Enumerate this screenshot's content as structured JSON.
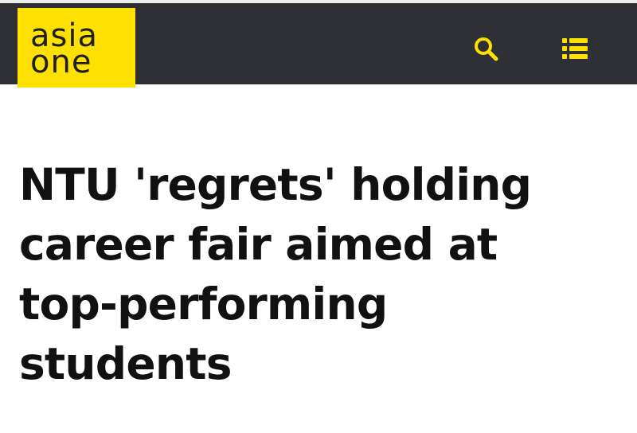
{
  "site": {
    "logo_line_1": "asia",
    "logo_line_2": "one",
    "brand_color": "#FFE100",
    "header_bg": "#2F3035"
  },
  "header": {
    "search_icon": "search-icon",
    "menu_icon": "menu-icon"
  },
  "article": {
    "headline_lines": [
      "NTU 'regrets' holding",
      "career fair aimed at",
      "top-performing",
      "students"
    ]
  }
}
